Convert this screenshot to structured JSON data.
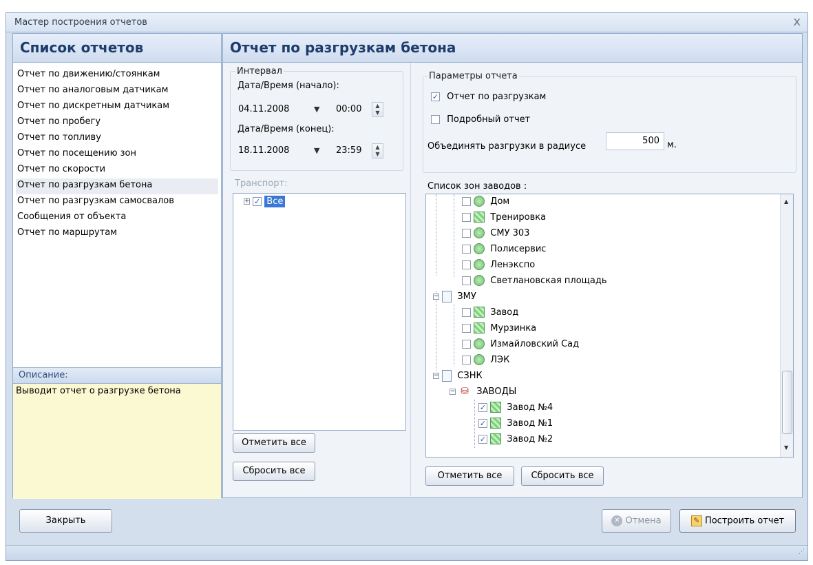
{
  "window": {
    "title": "Мастер построения отчетов",
    "close_glyph": "x"
  },
  "left_panel": {
    "header": "Список отчетов",
    "items": [
      {
        "label": "Отчет по движению/стоянкам"
      },
      {
        "label": "Отчет по аналоговым датчикам"
      },
      {
        "label": "Отчет по дискретным датчикам"
      },
      {
        "label": "Отчет по пробегу"
      },
      {
        "label": "Отчет по топливу"
      },
      {
        "label": "Отчет по посещению зон"
      },
      {
        "label": "Отчет по скорости"
      },
      {
        "label": "Отчет по разгрузкам бетона",
        "selected": true
      },
      {
        "label": "Отчет по разгрузкам самосвалов"
      },
      {
        "label": "Сообщения от объекта"
      },
      {
        "label": "Отчет по маршрутам"
      }
    ],
    "description_header": "Описание:",
    "description_text": "Выводит отчет о разгрузке бетона"
  },
  "main": {
    "header": "Отчет по разгрузкам бетона",
    "interval": {
      "group_label": "Интервал",
      "start_label": "Дата/Время (начало):",
      "start_date": "04.11.2008",
      "start_time": "00:00",
      "end_label": "Дата/Время (конец):",
      "end_date": "18.11.2008",
      "end_time": "23:59"
    },
    "transport": {
      "label": "Транспорт:",
      "tree_root": "Все",
      "select_all": "Отметить все",
      "reset_all": "Сбросить все"
    },
    "params": {
      "group_label": "Параметры отчета",
      "unload_report_label": "Отчет по разгрузкам",
      "unload_report_checked": true,
      "detailed_label": "Подробный отчет",
      "detailed_checked": false,
      "radius_label": "Объединять разгрузки в радиусе",
      "radius_value": "500",
      "radius_unit": "м.",
      "zones_label": "Список зон заводов :",
      "select_all": "Отметить все",
      "reset_all": "Сбросить все"
    },
    "zones_tree": [
      {
        "label": "Дом",
        "icon": "circle-zone-icon",
        "checked": false
      },
      {
        "label": "Тренировка",
        "icon": "square-zone-icon",
        "checked": false
      },
      {
        "label": "СМУ 303",
        "icon": "circle-zone-icon",
        "checked": false
      },
      {
        "label": "Полисервис",
        "icon": "circle-zone-icon",
        "checked": false
      },
      {
        "label": "Ленэкспо",
        "icon": "circle-zone-icon",
        "checked": false
      },
      {
        "label": "Светлановская площадь",
        "icon": "circle-zone-icon",
        "checked": false
      },
      {
        "label": "ЗМУ",
        "icon": "document-icon",
        "group": true
      },
      {
        "label": "Завод",
        "icon": "square-zone-icon",
        "checked": false
      },
      {
        "label": "Мурзинка",
        "icon": "square-zone-icon",
        "checked": false
      },
      {
        "label": "Измайловский Сад",
        "icon": "circle-zone-icon",
        "checked": false
      },
      {
        "label": "ЛЭК",
        "icon": "circle-zone-icon",
        "checked": false
      },
      {
        "label": "СЗНК",
        "icon": "document-icon",
        "group": true
      },
      {
        "label": "ЗАВОДЫ",
        "icon": "group-icon",
        "group": true
      },
      {
        "label": "Завод №4",
        "icon": "square-zone-icon",
        "checked": true
      },
      {
        "label": "Завод №1",
        "icon": "square-zone-icon",
        "checked": true
      },
      {
        "label": "Завод №2",
        "icon": "square-zone-icon",
        "checked": true
      }
    ]
  },
  "footer": {
    "close_button": "Закрыть",
    "cancel_button": "Отмена",
    "build_button": "Построить отчет"
  }
}
